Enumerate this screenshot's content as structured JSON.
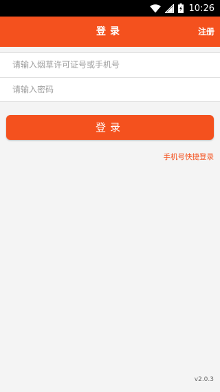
{
  "status_bar": {
    "time": "10:26",
    "icons": [
      "wifi-icon",
      "signal-icon",
      "battery-icon"
    ]
  },
  "app_bar": {
    "title": "登录",
    "register_label": "注册"
  },
  "form": {
    "account_placeholder": "请输入烟草许可证号或手机号",
    "password_placeholder": "请输入密码"
  },
  "login_button_label": "登录",
  "quick_login_label": "手机号快捷登录",
  "version": "v2.0.3",
  "colors": {
    "primary": "#f4511e",
    "background": "#f4f4f4"
  }
}
